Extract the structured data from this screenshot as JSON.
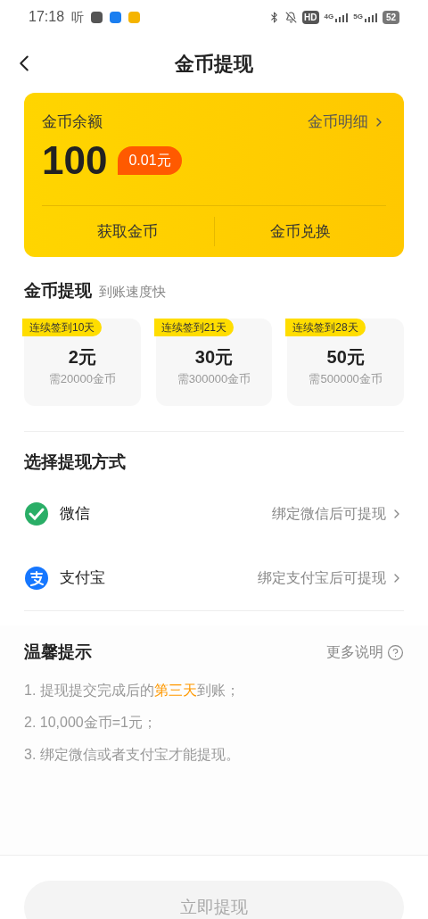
{
  "status_bar": {
    "time": "17:18",
    "app_glyph": "听",
    "hd": "HD",
    "networks": [
      "4G",
      "5G"
    ],
    "battery": "52"
  },
  "header": {
    "title": "金币提现"
  },
  "balance_card": {
    "label": "金币余额",
    "detail_link": "金币明细",
    "amount": "100",
    "value_badge": "0.01元",
    "actions": [
      "获取金币",
      "金币兑换"
    ]
  },
  "withdraw": {
    "title": "金币提现",
    "subtitle": "到账速度快",
    "options": [
      {
        "tag": "连续签到10天",
        "amount": "2元",
        "cost": "需20000金币",
        "selected": false
      },
      {
        "tag": "连续签到21天",
        "amount": "30元",
        "cost": "需300000金币",
        "selected": false
      },
      {
        "tag": "连续签到28天",
        "amount": "50元",
        "cost": "需500000金币",
        "selected": false
      }
    ]
  },
  "methods": {
    "title": "选择提现方式",
    "items": [
      {
        "kind": "wechat",
        "name": "微信",
        "hint": "绑定微信后可提现"
      },
      {
        "kind": "alipay",
        "name": "支付宝",
        "hint": "绑定支付宝后可提现"
      }
    ]
  },
  "tips": {
    "title": "温馨提示",
    "more": "更多说明",
    "items": [
      {
        "before": "1. 提现提交完成后的",
        "highlight": "第三天",
        "after": "到账；"
      },
      {
        "before": "2. 10,000金币=1元；"
      },
      {
        "before": "3. 绑定微信或者支付宝才能提现。"
      }
    ]
  },
  "submit": {
    "label": "立即提现",
    "disabled": true
  }
}
